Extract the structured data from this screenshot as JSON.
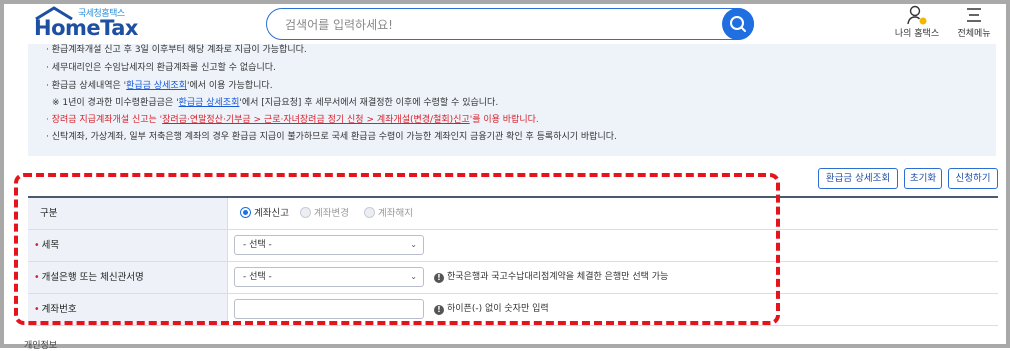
{
  "header": {
    "logo_sub": "국세청홈택스",
    "logo_main": "HomeTax",
    "search_placeholder": "검색어를 입력하세요!",
    "my_hometax": "나의 홈택스",
    "full_menu": "전체메뉴"
  },
  "notice": {
    "line1": "· 환급계좌개설 신고 후 3일 이후부터 해당 계좌로 지급이 가능합니다.",
    "line2": "· 세무대리인은 수임납세자의 환급계좌를 신고할 수 없습니다.",
    "line3_pre": "· 환급금 상세내역은 '",
    "line3_link": "환급금 상세조회",
    "line3_post": "'에서 이용 가능합니다.",
    "line4_pre": "※ 1년이 경과한 미수령환급금은 '",
    "line4_link": "환급금 상세조회",
    "line4_post": "'에서 [지급요청] 후 세무서에서 재결정한 이후에 수령할 수 있습니다.",
    "line5_pre": "· 장려금 지급계좌개설 신고는 '",
    "line5_link": "장려금·연말정산·기부금 > 근로·자녀장려금 정기 신청 > 계좌개설(변경/철회)신고",
    "line5_post": "'를 이용 바랍니다.",
    "line6": "· 신탁계좌, 가상계좌, 일부 저축은행 계좌의 경우 환급금 지급이 불가하므로 국세 환급금 수령이 가능한 계좌인지 금융기관 확인 후 등록하시기 바랍니다."
  },
  "actions": {
    "refund_detail": "환급금 상세조회",
    "reset": "초기화",
    "apply": "신청하기"
  },
  "form": {
    "type_label": "구분",
    "type_options": [
      "계좌신고",
      "계좌변경",
      "계좌해지"
    ],
    "tax_label": "세목",
    "tax_value": "- 선택 -",
    "bank_label": "개설은행 또는 체신관서명",
    "bank_value": "- 선택 -",
    "bank_hint": "한국은행과 국고수납대리점계약을 체결한 은행만 선택 가능",
    "account_label": "계좌번호",
    "account_value": "",
    "account_hint": "하이픈(-) 없이 숫자만 입력"
  },
  "footer": {
    "cut_text": "개인정보"
  }
}
